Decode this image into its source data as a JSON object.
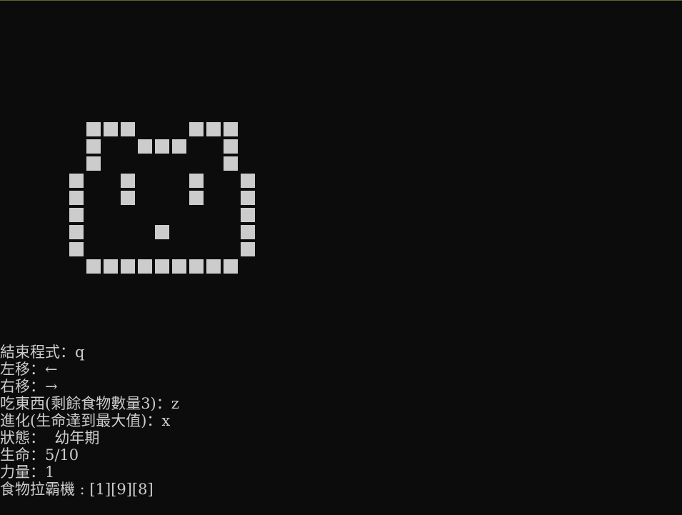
{
  "colors": {
    "background": "#0c0c0c",
    "foreground": "#cccccc"
  },
  "pet_sprite": {
    "rows": [
      "XXX....XXX",
      "X..XXX...X",
      "X........X",
      "X..X...X..X",
      "X..X...X..X",
      "X.........X",
      "X....X....X",
      "X.........X",
      ".XXXXXXXXX."
    ]
  },
  "controls": {
    "quit": "結束程式：q",
    "move_left": "左移：←",
    "move_right": "右移：→",
    "eat": "吃東西(剩餘食物數量3)：z",
    "evolve": "進化(生命達到最大值)：x"
  },
  "status": {
    "state": "狀態：  幼年期",
    "life": "生命：5/10",
    "power": "力量：1",
    "slot_machine": "食物拉霸機 : [1][9][8]"
  }
}
